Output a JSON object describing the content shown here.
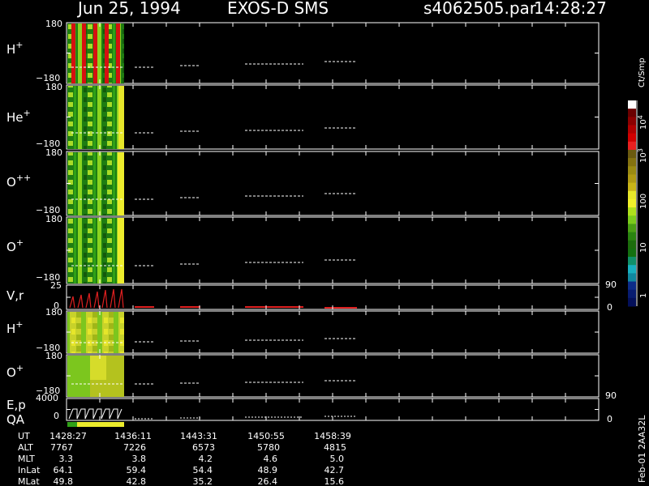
{
  "header": {
    "date": "Jun 25, 1994",
    "mission": "EXOS-D SMS",
    "file": "s4062505.par",
    "time": "14:28:27"
  },
  "panels": [
    {
      "id": "h1",
      "label_base": "H",
      "label_sup": "+",
      "top": "180",
      "bottom": "−180"
    },
    {
      "id": "he",
      "label_base": "He",
      "label_sup": "+",
      "top": "180",
      "bottom": "−180"
    },
    {
      "id": "opp",
      "label_base": "O",
      "label_sup": "++",
      "top": "180",
      "bottom": "−180"
    },
    {
      "id": "o1",
      "label_base": "O",
      "label_sup": "+",
      "top": "180",
      "bottom": "−180"
    },
    {
      "id": "vr",
      "label_base": "V,r",
      "label_sup": "",
      "top": "25",
      "bottom": "0",
      "right_top": "90",
      "right_bottom": "0"
    },
    {
      "id": "h2",
      "label_base": "H",
      "label_sup": "+",
      "top": "180",
      "bottom": "−180"
    },
    {
      "id": "o2",
      "label_base": "O",
      "label_sup": "+",
      "top": "180",
      "bottom": "−180"
    },
    {
      "id": "ep",
      "label_base": "E,p",
      "label_line2": "QA",
      "label_sup": "",
      "top": "4000",
      "bottom": "0",
      "right_top": "90",
      "right_bottom": "0"
    }
  ],
  "colorbar": {
    "unit": "Ct/Smp",
    "ticks": [
      {
        "base": "10",
        "exp": "4"
      },
      {
        "base": "10",
        "exp": "3"
      },
      {
        "base": "100",
        "exp": ""
      },
      {
        "base": "10",
        "exp": ""
      },
      {
        "base": "1",
        "exp": ""
      }
    ]
  },
  "footer": {
    "row_labels": [
      "UT",
      "ALT",
      "MLT",
      "InLat",
      "MLat"
    ],
    "columns": [
      {
        "UT": "1428:27",
        "ALT": "7767",
        "MLT": "3.3",
        "InLat": "64.1",
        "MLat": "49.8"
      },
      {
        "UT": "1436:11",
        "ALT": "7226",
        "MLT": "3.8",
        "InLat": "59.4",
        "MLat": "42.8"
      },
      {
        "UT": "1443:31",
        "ALT": "6573",
        "MLT": "4.2",
        "InLat": "54.4",
        "MLat": "35.2"
      },
      {
        "UT": "1450:55",
        "ALT": "5780",
        "MLT": "4.6",
        "InLat": "48.9",
        "MLat": "26.4"
      },
      {
        "UT": "1458:39",
        "ALT": "4815",
        "MLT": "5.0",
        "InLat": "42.7",
        "MLat": "15.6"
      }
    ]
  },
  "side_note": "Feb-01  2AA32L",
  "colors": {
    "background": "#000000",
    "axes": "#ffffff",
    "spectrum_high": "#e00000",
    "spectrum_mid": "#1d8a10",
    "spectrum_low": "#e8e800"
  },
  "chart_data": {
    "type": "heatmap",
    "ut_ticks": [
      "1428:27",
      "1436:11",
      "1443:31",
      "1450:55",
      "1458:39"
    ],
    "colorbar_range": [
      1,
      10000
    ],
    "colorbar_scale": "log",
    "grid": false
  }
}
